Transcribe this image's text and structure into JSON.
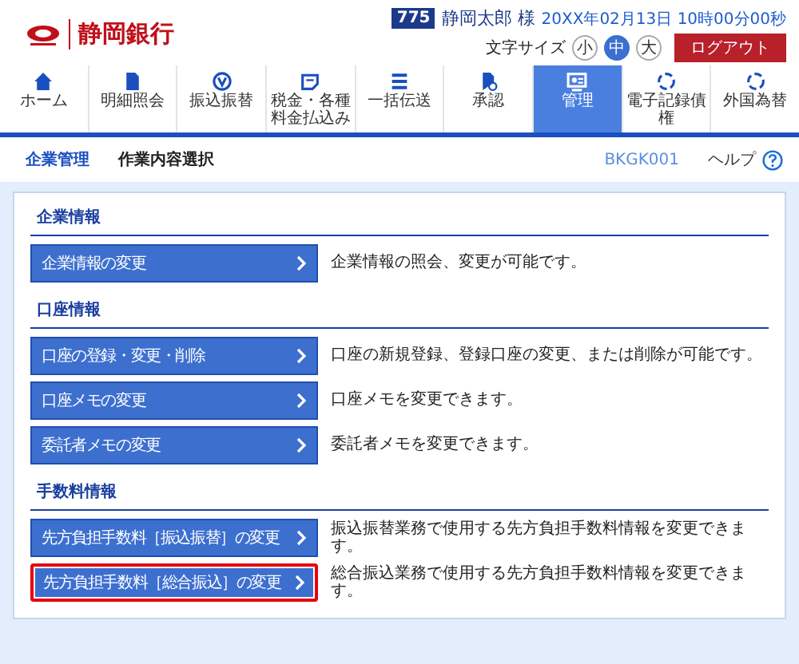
{
  "header": {
    "bank_name": "静岡銀行",
    "user_badge": "775",
    "user_name": "静岡太郎 様",
    "datetime": "20XX年02月13日 10時00分00秒",
    "font_size_label": "文字サイズ",
    "font_sizes": [
      {
        "label": "小",
        "selected": false
      },
      {
        "label": "中",
        "selected": true
      },
      {
        "label": "大",
        "selected": false
      }
    ],
    "logout": "ログアウト"
  },
  "nav": [
    {
      "label": "ホーム",
      "selected": false
    },
    {
      "label": "明細照会",
      "selected": false
    },
    {
      "label": "振込振替",
      "selected": false
    },
    {
      "label": "税金・各種料金払込み",
      "selected": false
    },
    {
      "label": "一括伝送",
      "selected": false
    },
    {
      "label": "承認",
      "selected": false
    },
    {
      "label": "管理",
      "selected": true
    },
    {
      "label": "電子記録債権",
      "selected": false
    },
    {
      "label": "外国為替",
      "selected": false
    }
  ],
  "breadcrumb": {
    "section": "企業管理",
    "page": "作業内容選択",
    "screen_id": "BKGK001",
    "help": "ヘルプ"
  },
  "sections": [
    {
      "title": "企業情報",
      "items": [
        {
          "button": "企業情報の変更",
          "description": "企業情報の照会、変更が可能です。",
          "highlighted": false
        }
      ]
    },
    {
      "title": "口座情報",
      "items": [
        {
          "button": "口座の登録・変更・削除",
          "description": "口座の新規登録、登録口座の変更、または削除が可能です。",
          "highlighted": false
        },
        {
          "button": "口座メモの変更",
          "description": "口座メモを変更できます。",
          "highlighted": false
        },
        {
          "button": "委託者メモの変更",
          "description": "委託者メモを変更できます。",
          "highlighted": false
        }
      ]
    },
    {
      "title": "手数料情報",
      "items": [
        {
          "button": "先方負担手数料［振込振替］の変更",
          "description": "振込振替業務で使用する先方負担手数料情報を変更できます。",
          "highlighted": false
        },
        {
          "button": "先方負担手数料［総合振込］の変更",
          "description": "総合振込業務で使用する先方負担手数料情報を変更できます。",
          "highlighted": true
        }
      ]
    }
  ]
}
